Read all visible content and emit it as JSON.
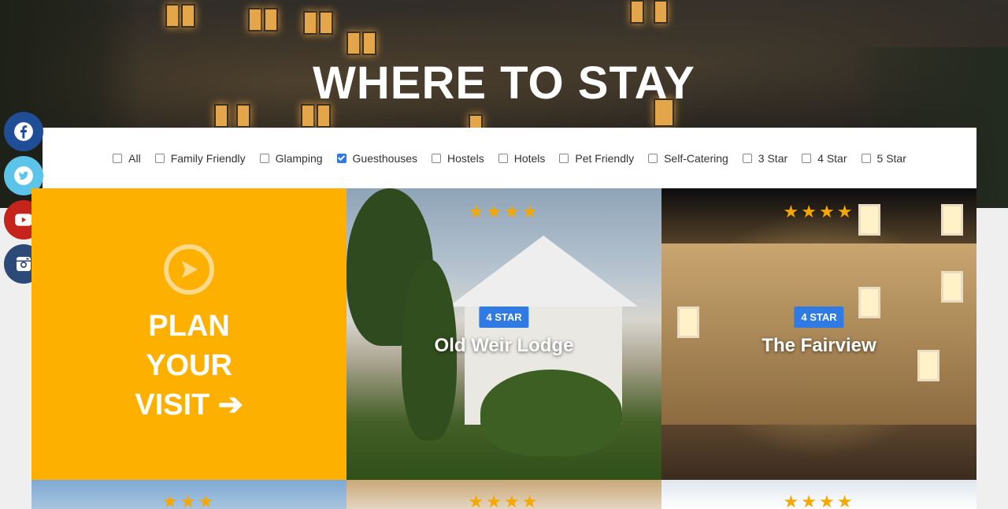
{
  "hero": {
    "title": "WHERE TO STAY"
  },
  "filters": [
    {
      "label": "All",
      "checked": false
    },
    {
      "label": "Family Friendly",
      "checked": false
    },
    {
      "label": "Glamping",
      "checked": false
    },
    {
      "label": "Guesthouses",
      "checked": true
    },
    {
      "label": "Hostels",
      "checked": false
    },
    {
      "label": "Hotels",
      "checked": false
    },
    {
      "label": "Pet Friendly",
      "checked": false
    },
    {
      "label": "Self-Catering",
      "checked": false
    },
    {
      "label": "3 Star",
      "checked": false
    },
    {
      "label": "4 Star",
      "checked": false
    },
    {
      "label": "5 Star",
      "checked": false
    }
  ],
  "social": [
    "facebook-icon",
    "twitter-icon",
    "youtube-icon",
    "instagram-icon"
  ],
  "plan": {
    "line1": "PLAN",
    "line2": "YOUR",
    "line3": "VISIT",
    "arrow": "➔"
  },
  "cards": [
    {
      "stars": "★★★★",
      "badge": "4 STAR",
      "title": "Old Weir Lodge"
    },
    {
      "stars": "★★★★",
      "badge": "4 STAR",
      "title": "The Fairview"
    }
  ],
  "bottom_cards": [
    {
      "stars": "★★★"
    },
    {
      "stars": "★★★★"
    },
    {
      "stars": "★★★★"
    }
  ],
  "colors": {
    "accent": "#fdb000",
    "badge": "#2f7be3",
    "star": "#f6a800"
  }
}
